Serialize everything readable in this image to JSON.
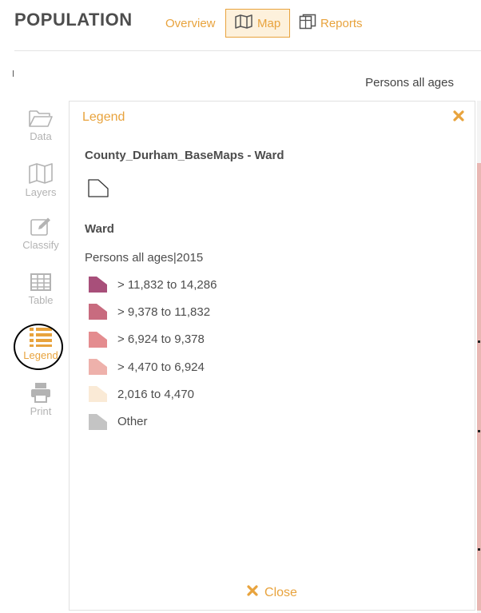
{
  "header": {
    "title": "POPULATION",
    "tabs": [
      {
        "label": "Overview",
        "icon": "none"
      },
      {
        "label": "Map",
        "icon": "map-icon",
        "active": true
      },
      {
        "label": "Reports",
        "icon": "reports-icon"
      }
    ]
  },
  "map": {
    "subtitle": "Persons all ages"
  },
  "sidebar": {
    "items": [
      {
        "label": "Data",
        "icon": "folder-icon"
      },
      {
        "label": "Layers",
        "icon": "map-layers-icon"
      },
      {
        "label": "Classify",
        "icon": "edit-icon"
      },
      {
        "label": "Table",
        "icon": "table-icon"
      },
      {
        "label": "Legend",
        "icon": "list-icon",
        "active": true
      },
      {
        "label": "Print",
        "icon": "printer-icon"
      }
    ]
  },
  "legend": {
    "title": "Legend",
    "layer_name": "County_Durham_BaseMaps - Ward",
    "ward_label": "Ward",
    "field_label": "Persons all ages|2015",
    "classes": [
      {
        "label": "> 11,832 to 14,286",
        "color": "#a84f7a"
      },
      {
        "label": "> 9,378 to 11,832",
        "color": "#c86b7f"
      },
      {
        "label": "> 6,924 to 9,378",
        "color": "#e48c8f"
      },
      {
        "label": "> 4,470 to 6,924",
        "color": "#eeb1ab"
      },
      {
        "label": "2,016 to 4,470",
        "color": "#faead6"
      },
      {
        "label": "Other",
        "color": "#c4c4c4"
      }
    ],
    "close_label": "Close"
  },
  "colors": {
    "accent": "#e8a33d",
    "text": "#4d4d4d",
    "inactive_icon": "#b3b3b3"
  }
}
